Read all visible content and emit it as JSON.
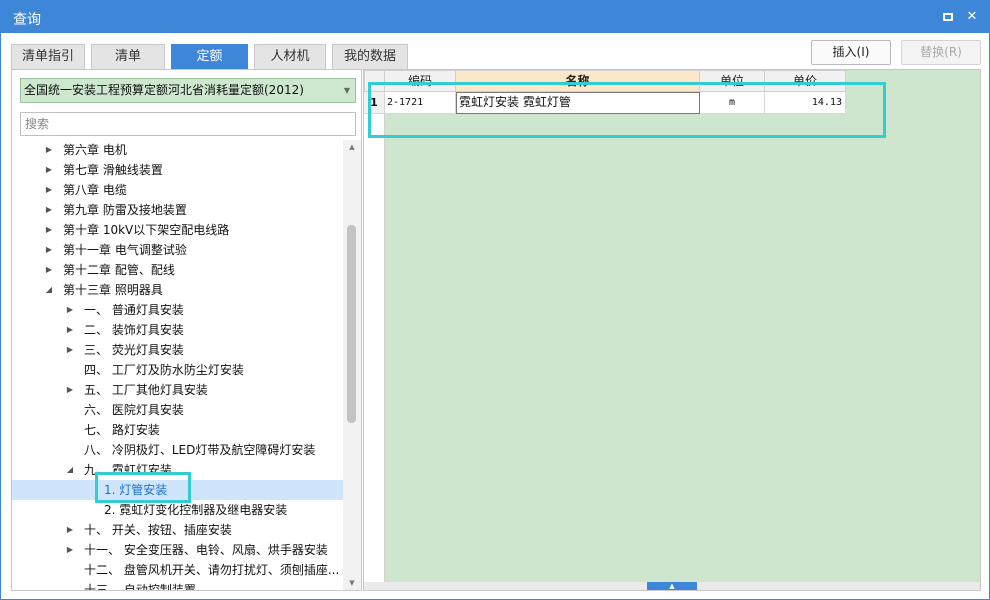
{
  "window": {
    "title": "查询",
    "maximize_label": "□",
    "close_label": "✕"
  },
  "tabs": [
    {
      "label": "清单指引"
    },
    {
      "label": "清单"
    },
    {
      "label": "定额",
      "active": true
    },
    {
      "label": "人材机"
    },
    {
      "label": "我的数据"
    }
  ],
  "toolbar": {
    "insert_label": "插入(I)",
    "replace_label": "替换(R)"
  },
  "left": {
    "quota_book": "全国统一安装工程预算定额河北省消耗量定额(2012)",
    "search_placeholder": "搜索",
    "tree": [
      {
        "label": "第六章 电机",
        "toggle": "▶"
      },
      {
        "label": "第七章 滑触线装置",
        "toggle": "▶"
      },
      {
        "label": "第八章 电缆",
        "toggle": "▶"
      },
      {
        "label": "第九章 防雷及接地装置",
        "toggle": "▶"
      },
      {
        "label": "第十章 10kV以下架空配电线路",
        "toggle": "▶"
      },
      {
        "label": "第十一章 电气调整试验",
        "toggle": "▶"
      },
      {
        "label": "第十二章 配管、配线",
        "toggle": "▶"
      },
      {
        "label": "第十三章 照明器具",
        "toggle": "◢"
      },
      {
        "label": "一、 普通灯具安装",
        "toggle": "▶"
      },
      {
        "label": "二、 装饰灯具安装",
        "toggle": "▶"
      },
      {
        "label": "三、 荧光灯具安装",
        "toggle": "▶"
      },
      {
        "label": "四、 工厂灯及防水防尘灯安装",
        "toggle": ""
      },
      {
        "label": "五、 工厂其他灯具安装",
        "toggle": "▶"
      },
      {
        "label": "六、 医院灯具安装",
        "toggle": ""
      },
      {
        "label": "七、 路灯安装",
        "toggle": ""
      },
      {
        "label": "八、 冷阴极灯、LED灯带及航空障碍灯安装",
        "toggle": ""
      },
      {
        "label": "九、 霓虹灯安装",
        "toggle": "◢"
      },
      {
        "label": "1. 灯管安装",
        "toggle": "",
        "selected": true
      },
      {
        "label": "2. 霓虹灯变化控制器及继电器安装",
        "toggle": ""
      },
      {
        "label": "十、 开关、按钮、插座安装",
        "toggle": "▶"
      },
      {
        "label": "十一、 安全变压器、电铃、风扇、烘手器安装",
        "toggle": "▶"
      },
      {
        "label": "十二、 盘管风机开关、请勿打扰灯、须刨插座...",
        "toggle": ""
      },
      {
        "label": "十三、 自动控制装置",
        "toggle": ""
      }
    ],
    "scroll_up": "▲",
    "scroll_down": "▼"
  },
  "grid": {
    "columns": [
      {
        "label": "编码"
      },
      {
        "label": "名称",
        "active": true
      },
      {
        "label": "单位"
      },
      {
        "label": "单价"
      }
    ],
    "rows": [
      {
        "index": "1",
        "code": "2-1721",
        "name": "霓虹灯安装 霓虹灯管",
        "unit": "m",
        "price": "14.13"
      }
    ],
    "splitter_glyph": "▲"
  },
  "colors": {
    "accent": "#3e87d8",
    "highlight": "#33ccd1",
    "grid_background": "#cde6cd",
    "selected_row": "#cfe5fb"
  }
}
